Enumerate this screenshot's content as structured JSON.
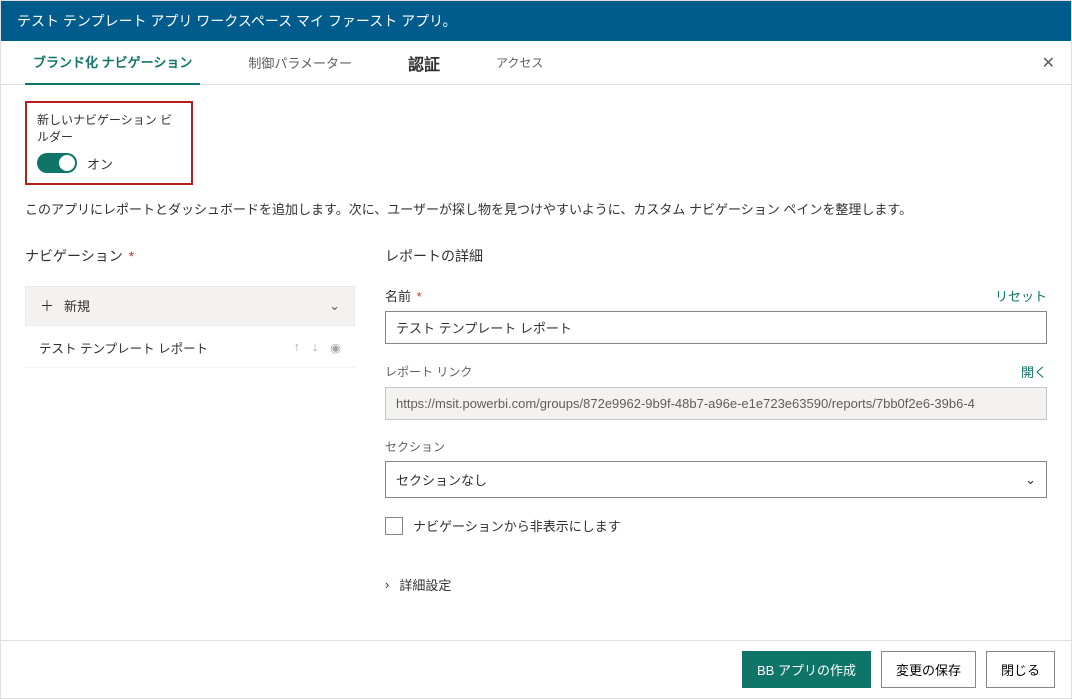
{
  "header": {
    "title": "テスト テンプレート アプリ ワークスペース マイ ファースト アプリ。"
  },
  "tabs": {
    "branding": "ブランド化 ナビゲーション",
    "params": "制御パラメーター",
    "auth": "認証",
    "access": "アクセス"
  },
  "builder": {
    "label": "新しいナビゲーション ビルダー",
    "state": "オン"
  },
  "description": "このアプリにレポートとダッシュボードを追加します。次に、ユーザーが探し物を見つけやすいように、カスタム ナビゲーション ペインを整理します。",
  "nav": {
    "title": "ナビゲーション",
    "new_label": "新規",
    "item0": "テスト テンプレート レポート"
  },
  "details": {
    "title": "レポートの詳細",
    "name_label": "名前",
    "reset": "リセット",
    "name_value": "テスト テンプレート レポート",
    "link_label": "レポート リンク",
    "open": "開く",
    "link_value": "https://msit.powerbi.com/groups/872e9962-9b9f-48b7-a96e-e1e723e63590/reports/7bb0f2e6-39b6-4",
    "section_label": "セクション",
    "section_value": "セクションなし",
    "hide_label": "ナビゲーションから非表示にします",
    "advanced": "詳細設定"
  },
  "footer": {
    "create": "BB アプリの作成",
    "save": "変更の保存",
    "close": "閉じる"
  }
}
